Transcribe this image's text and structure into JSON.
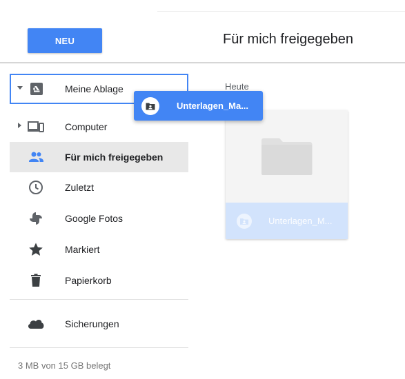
{
  "header": {
    "new_button": "NEU",
    "page_title": "Für mich freigegeben"
  },
  "sidebar": {
    "items": [
      {
        "label": "Meine Ablage",
        "icon": "drive-icon"
      },
      {
        "label": "Computer",
        "icon": "computer-icon"
      },
      {
        "label": "Für mich freigegeben",
        "icon": "shared-people-icon"
      },
      {
        "label": "Zuletzt",
        "icon": "clock-icon"
      },
      {
        "label": "Google Fotos",
        "icon": "google-photos-icon"
      },
      {
        "label": "Markiert",
        "icon": "star-icon"
      },
      {
        "label": "Papierkorb",
        "icon": "trash-icon"
      },
      {
        "label": "Sicherungen",
        "icon": "cloud-icon"
      }
    ],
    "storage_text": "3 MB von 15 GB belegt"
  },
  "main": {
    "section_label": "Heute",
    "files": [
      {
        "name": "Unterlagen_M...",
        "type": "shared-folder"
      }
    ]
  },
  "drag": {
    "label": "Unterlagen_Ma..."
  },
  "colors": {
    "accent": "#4285f4",
    "selected_bg": "#e8e8e8",
    "file_selected_bg": "#d2e3fc",
    "icon_gray": "#5f6368",
    "shared_icon": "#4285f4"
  }
}
